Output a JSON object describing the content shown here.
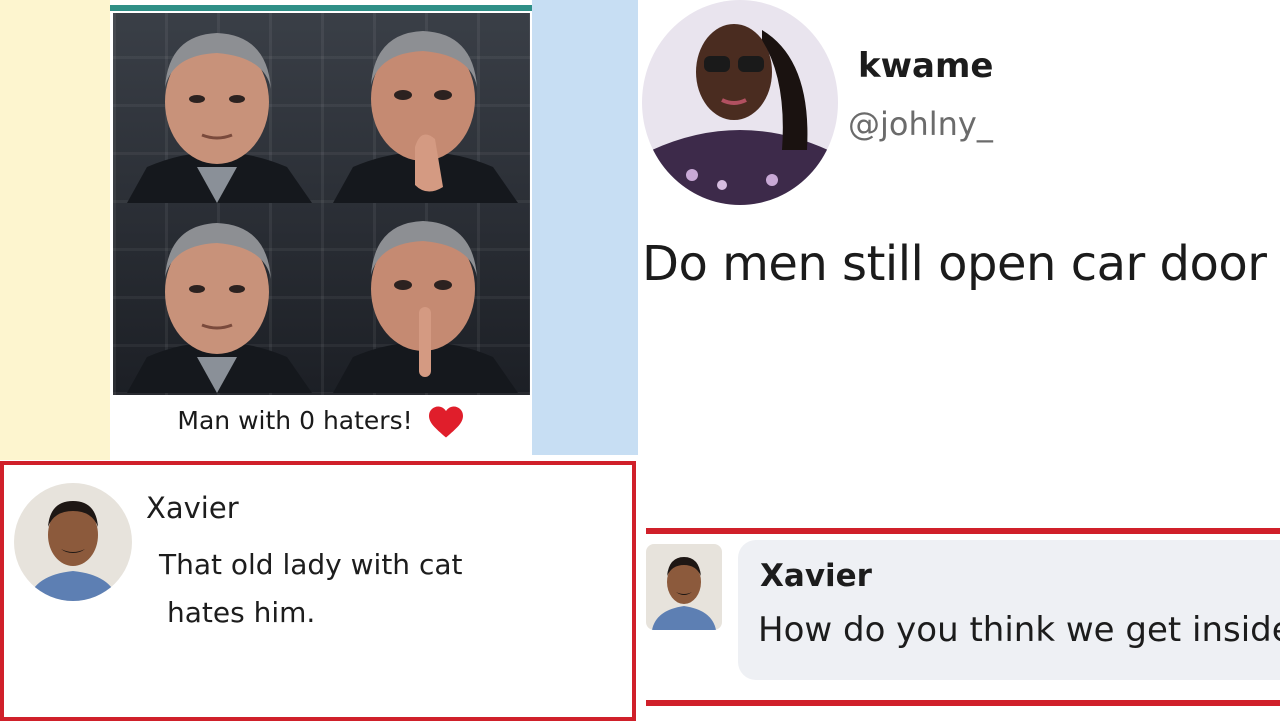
{
  "left": {
    "meme": {
      "caption": "Man with 0 haters!",
      "heart_icon": "heart-icon"
    },
    "comment": {
      "name": "Xavier",
      "text_line1": "That old lady with cat",
      "text_line2": "hates him."
    }
  },
  "right": {
    "profile": {
      "display_name": "kwame",
      "handle": "@johlny_"
    },
    "post": {
      "text": "Do men still open car door"
    },
    "comment": {
      "name": "Xavier",
      "text": "How do you think we get inside"
    }
  },
  "colors": {
    "accent_red": "#d0202a",
    "teal_bar": "#2f8f87",
    "left_bg_yellow": "#fdf5cf",
    "left_bg_blue": "#c7def3",
    "bubble": "#eef0f4"
  }
}
